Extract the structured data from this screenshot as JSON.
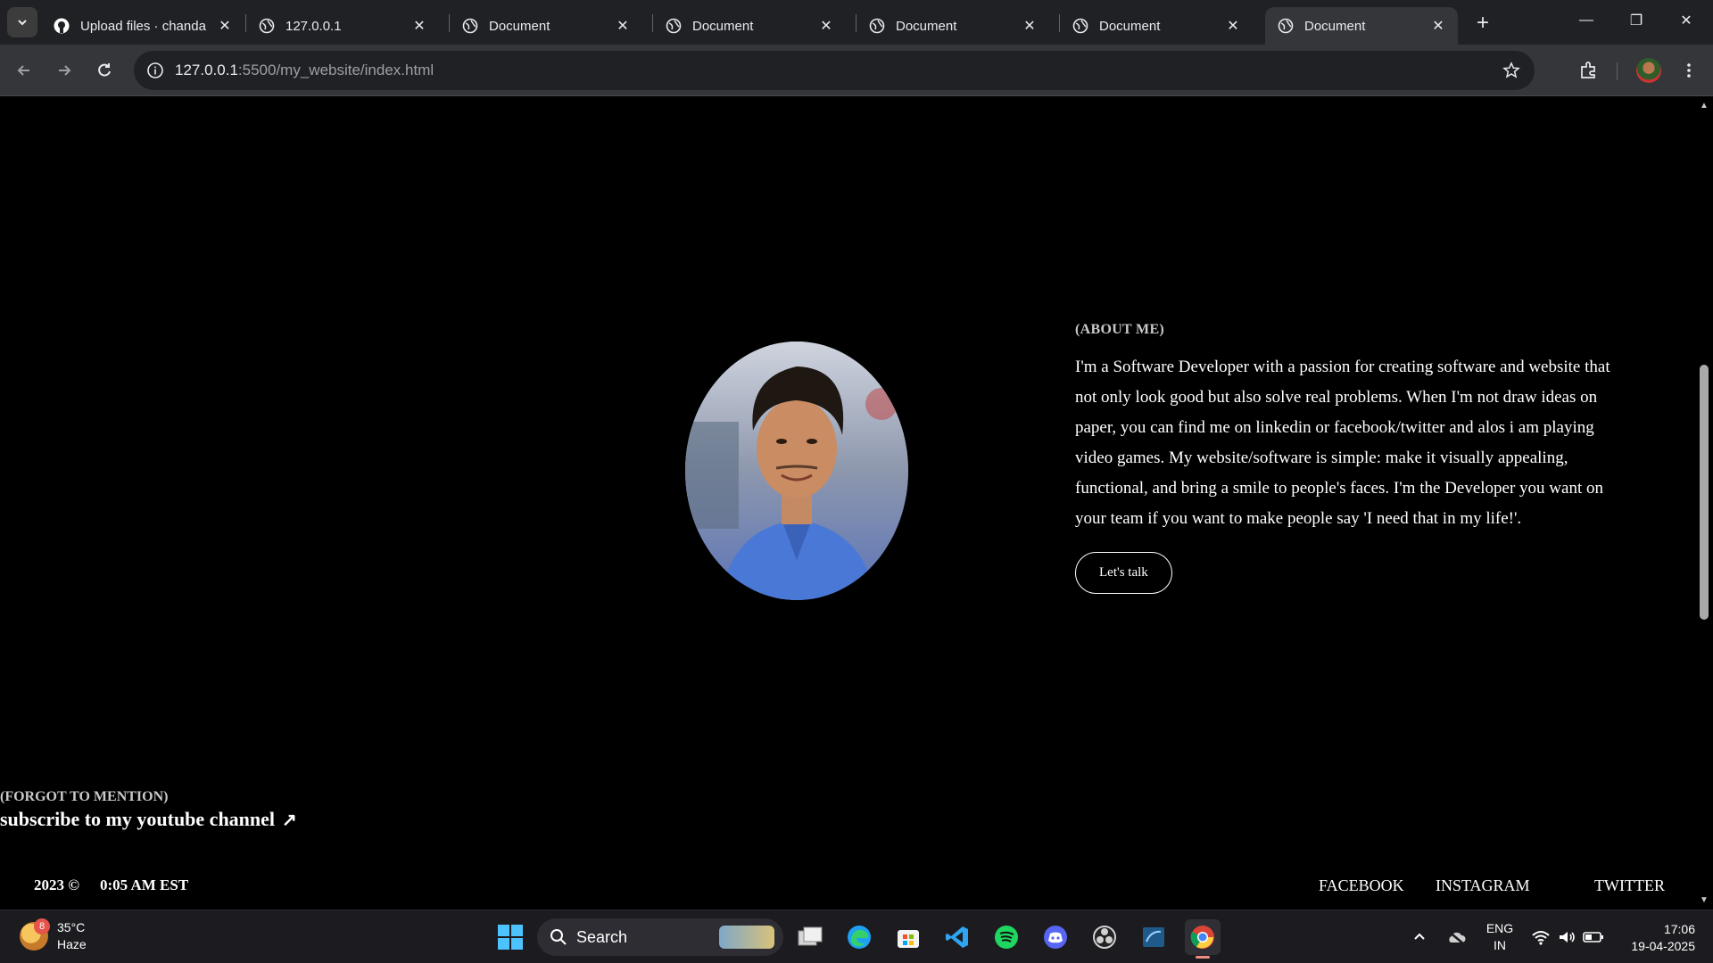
{
  "browser": {
    "tabs": [
      {
        "title": "Upload files · chanda",
        "icon": "github-icon",
        "active": false
      },
      {
        "title": "127.0.0.1",
        "icon": "globe-icon",
        "active": false
      },
      {
        "title": "Document",
        "icon": "globe-icon",
        "active": false
      },
      {
        "title": "Document",
        "icon": "globe-icon",
        "active": false
      },
      {
        "title": "Document",
        "icon": "globe-icon",
        "active": false
      },
      {
        "title": "Document",
        "icon": "globe-icon",
        "active": false
      },
      {
        "title": "Document",
        "icon": "globe-icon",
        "active": true
      }
    ],
    "url_host": "127.0.0.1",
    "url_rest": ":5500/my_website/index.html"
  },
  "page": {
    "about_label": "(ABOUT ME)",
    "about_text": "I'm a Software Developer with a passion for creating software and website that not only look good but also solve real problems. When I'm not draw ideas on paper, you can find me on linkedin or facebook/twitter and alos i am playing video games. My website/software is simple: make it visually appealing, functional, and bring a smile to people's faces. I'm the Developer you want on your team if you want to make people say 'I need that in my life!'.",
    "talk_button": "Let's talk",
    "forgot_label": "(FORGOT TO MENTION)",
    "subscribe_text": "subscribe to my youtube channel",
    "subscribe_arrow": "↗",
    "footer_year": "2023 ©",
    "footer_time": "0:05 AM EST",
    "social": {
      "facebook": "FACEBOOK",
      "instagram": "INSTAGRAM",
      "twitter": "TWITTER"
    }
  },
  "taskbar": {
    "weather_temp": "35°C",
    "weather_desc": "Haze",
    "weather_badge": "8",
    "search_label": "Search",
    "lang_line1": "ENG",
    "lang_line2": "IN",
    "time": "17:06",
    "date": "19-04-2025"
  },
  "colors": {
    "page_bg": "#000000",
    "tabstrip_bg": "#202124",
    "toolbar_bg": "#35363a",
    "taskbar_bg": "#1c1c20",
    "muted_label": "#c9c9c9"
  }
}
